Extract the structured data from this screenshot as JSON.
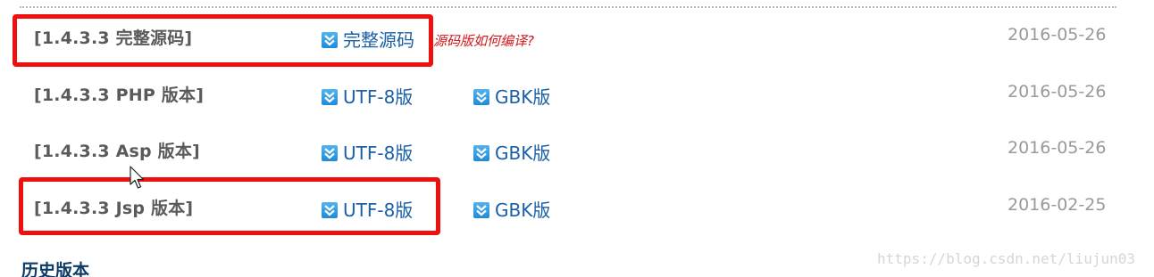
{
  "downloads": [
    {
      "version": "[1.4.3.3 完整源码]",
      "links": [
        {
          "label": "完整源码",
          "icon": "download-arrow-icon"
        }
      ],
      "note": "源码版如何编译?",
      "date": "2016-05-26",
      "highlighted": true
    },
    {
      "version": "[1.4.3.3 PHP 版本]",
      "links": [
        {
          "label": "UTF-8版",
          "icon": "download-arrow-icon"
        },
        {
          "label": "GBK版",
          "icon": "download-arrow-icon"
        }
      ],
      "date": "2016-05-26",
      "highlighted": false
    },
    {
      "version": "[1.4.3.3 Asp 版本]",
      "links": [
        {
          "label": "UTF-8版",
          "icon": "download-arrow-icon"
        },
        {
          "label": "GBK版",
          "icon": "download-arrow-icon"
        }
      ],
      "date": "2016-05-26",
      "highlighted": false
    },
    {
      "version": "[1.4.3.3 Jsp 版本]",
      "links": [
        {
          "label": "UTF-8版",
          "icon": "download-arrow-icon"
        },
        {
          "label": "GBK版",
          "icon": "download-arrow-icon"
        }
      ],
      "date": "2016-02-25",
      "highlighted": true
    }
  ],
  "history_heading": "历史版本",
  "watermark": "https://blog.csdn.net/liujun03",
  "colors": {
    "highlight": "#ef0f0f",
    "link": "#1a5fa8",
    "note": "#d3171b",
    "date": "#9a9a9a",
    "heading": "#0d3a66"
  }
}
